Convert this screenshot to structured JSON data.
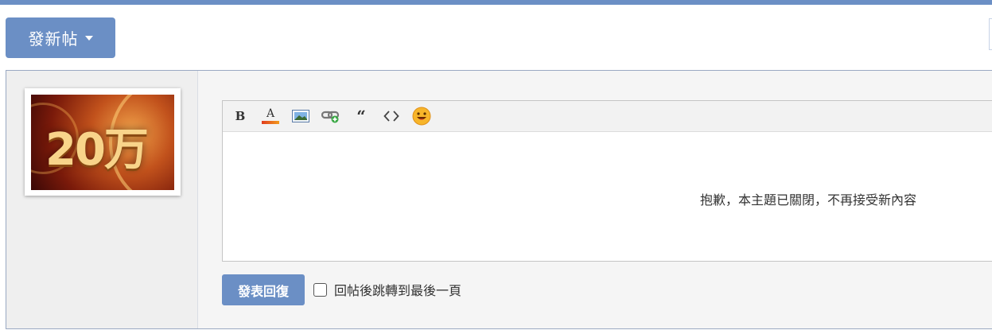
{
  "header": {
    "new_thread_label": "發新帖",
    "accent_color": "#6b8fc5"
  },
  "sidebar": {
    "avatar_text": "20万"
  },
  "editor": {
    "toolbar": [
      {
        "name": "bold",
        "label": "B"
      },
      {
        "name": "font-color",
        "label": "A"
      },
      {
        "name": "image",
        "label": ""
      },
      {
        "name": "link",
        "label": ""
      },
      {
        "name": "quote",
        "label": "“"
      },
      {
        "name": "code",
        "label": "<>"
      },
      {
        "name": "emoji",
        "label": ""
      }
    ],
    "closed_message": "抱歉，本主題已關閉，不再接受新內容"
  },
  "footer": {
    "submit_label": "發表回復",
    "jump_label": "回帖後跳轉到最後一頁",
    "jump_checked": false
  }
}
